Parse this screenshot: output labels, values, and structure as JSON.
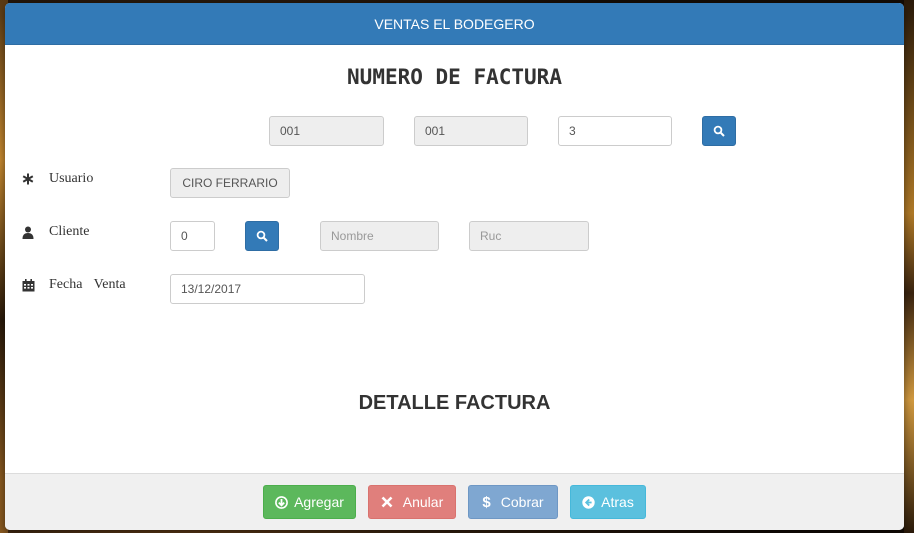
{
  "window": {
    "title": "VENTAS EL BODEGERO"
  },
  "invoice_number": {
    "heading": "NUMERO DE FACTURA",
    "establishment": "001",
    "emission_point": "001",
    "sequence": "3",
    "search_icon": "search-icon"
  },
  "user": {
    "label": "Usuario",
    "icon": "asterisk-icon",
    "value": "CIRO FERRARIO"
  },
  "client": {
    "label": "Cliente",
    "icon": "user-icon",
    "id_value": "0",
    "name_placeholder": "Nombre",
    "ruc_placeholder": "Ruc"
  },
  "sale_date": {
    "label": "Fecha Venta",
    "icon": "calendar-icon",
    "value": "13/12/2017"
  },
  "detail": {
    "heading": "DETALLE FACTURA"
  },
  "footer": {
    "add_label": "Agregar",
    "cancel_label": "Anular",
    "charge_label": "Cobrar",
    "back_label": "Atras"
  },
  "colors": {
    "primary": "#337ab7",
    "success": "#5cb85c",
    "danger": "#e07f7c",
    "info": "#5bc0de"
  }
}
